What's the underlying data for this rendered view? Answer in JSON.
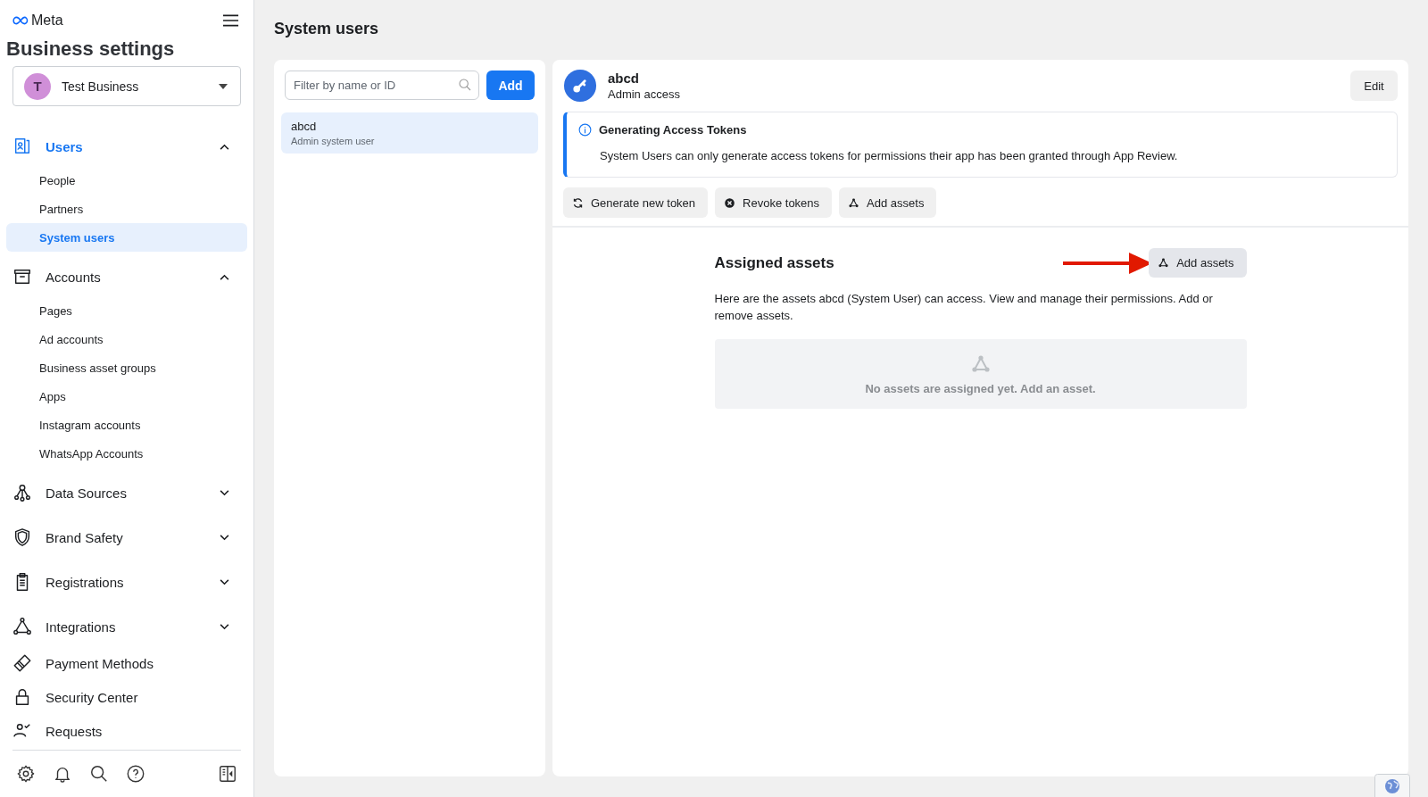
{
  "sidebar": {
    "brand": "Meta",
    "title": "Business settings",
    "business": {
      "initial": "T",
      "name": "Test Business"
    },
    "nav": [
      {
        "label": "Users",
        "kind": "group",
        "expanded": true,
        "selected": true,
        "children": [
          {
            "label": "People",
            "selected": false
          },
          {
            "label": "Partners",
            "selected": false
          },
          {
            "label": "System users",
            "selected": true
          }
        ]
      },
      {
        "label": "Accounts",
        "kind": "group",
        "expanded": true,
        "selected": false,
        "children": [
          {
            "label": "Pages",
            "selected": false
          },
          {
            "label": "Ad accounts",
            "selected": false
          },
          {
            "label": "Business asset groups",
            "selected": false
          },
          {
            "label": "Apps",
            "selected": false
          },
          {
            "label": "Instagram accounts",
            "selected": false
          },
          {
            "label": "WhatsApp Accounts",
            "selected": false
          }
        ]
      },
      {
        "label": "Data Sources",
        "kind": "group",
        "expanded": false,
        "selected": false
      },
      {
        "label": "Brand Safety",
        "kind": "group",
        "expanded": false,
        "selected": false
      },
      {
        "label": "Registrations",
        "kind": "group",
        "expanded": false,
        "selected": false
      },
      {
        "label": "Integrations",
        "kind": "group",
        "expanded": false,
        "selected": false
      },
      {
        "label": "Payment Methods",
        "kind": "link",
        "selected": false
      },
      {
        "label": "Security Center",
        "kind": "link",
        "selected": false
      },
      {
        "label": "Requests",
        "kind": "link",
        "selected": false
      }
    ]
  },
  "page_title": "System users",
  "user_list": {
    "search": {
      "placeholder": "Filter by name or ID"
    },
    "add_button": "Add",
    "items": [
      {
        "name": "abcd",
        "role": "Admin system user",
        "selected": true
      }
    ]
  },
  "detail": {
    "name": "abcd",
    "access": "Admin access",
    "edit_button": "Edit",
    "notice": {
      "title": "Generating Access Tokens",
      "text": "System Users can only generate access tokens for permissions their app has been granted through App Review."
    },
    "actions": [
      "Generate new token",
      "Revoke tokens",
      "Add assets"
    ],
    "assets": {
      "title": "Assigned assets",
      "add_button": "Add assets",
      "description": "Here are the assets abcd (System User) can access. View and manage their permissions. Add or remove assets.",
      "empty_text": "No assets are assigned yet. Add an asset."
    }
  }
}
